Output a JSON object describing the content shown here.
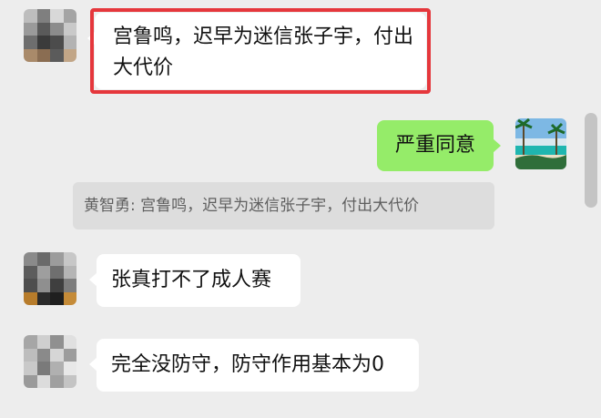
{
  "messages": [
    {
      "text": "宫鲁鸣，迟早为迷信张子宇，付出大代价",
      "side": "left",
      "highlighted": true,
      "highlight_color": "#e5373c"
    },
    {
      "text": "严重同意",
      "side": "right",
      "bubble_color": "#95ec69"
    },
    {
      "text": "张真打不了成人赛",
      "side": "left"
    },
    {
      "text": "完全没防守，防守作用基本为0",
      "side": "left"
    }
  ],
  "quote": {
    "text": "黄智勇: 宫鲁鸣，迟早为迷信张子宇，付出大代价"
  },
  "colors": {
    "background": "#ededed",
    "bubble_white": "#ffffff",
    "bubble_green": "#95ec69",
    "quote_bg": "#dddddd"
  }
}
